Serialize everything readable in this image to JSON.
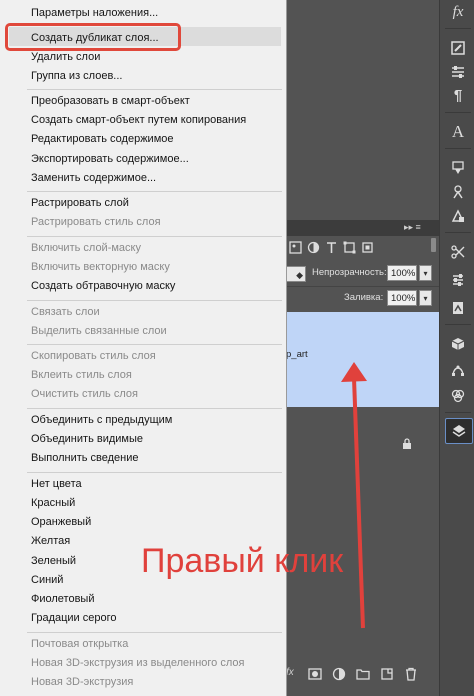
{
  "context_menu": {
    "items": [
      {
        "label": "Параметры наложения...",
        "enabled": true
      },
      {
        "label": "Создать дубликат слоя...",
        "enabled": true,
        "highlighted": true
      },
      {
        "label": "Удалить слои",
        "enabled": true
      },
      {
        "label": "Группа из слоев...",
        "enabled": true
      },
      {
        "label": "Преобразовать в смарт-объект",
        "enabled": true
      },
      {
        "label": "Создать смарт-объект путем копирования",
        "enabled": true
      },
      {
        "label": "Редактировать содержимое",
        "enabled": true
      },
      {
        "label": "Экспортировать содержимое...",
        "enabled": true
      },
      {
        "label": "Заменить содержимое...",
        "enabled": true
      },
      {
        "label": "Растрировать слой",
        "enabled": true
      },
      {
        "label": "Растрировать стиль слоя",
        "enabled": false
      },
      {
        "label": "Включить слой-маску",
        "enabled": false
      },
      {
        "label": "Включить векторную маску",
        "enabled": false
      },
      {
        "label": "Создать обтравочную маску",
        "enabled": true
      },
      {
        "label": "Связать слои",
        "enabled": false
      },
      {
        "label": "Выделить связанные слои",
        "enabled": false
      },
      {
        "label": "Скопировать стиль слоя",
        "enabled": false
      },
      {
        "label": "Вклеить стиль слоя",
        "enabled": false
      },
      {
        "label": "Очистить стиль слоя",
        "enabled": false
      },
      {
        "label": "Объединить с предыдущим",
        "enabled": true
      },
      {
        "label": "Объединить видимые",
        "enabled": true
      },
      {
        "label": "Выполнить сведение",
        "enabled": true
      },
      {
        "label": "Нет цвета",
        "enabled": true
      },
      {
        "label": "Красный",
        "enabled": true
      },
      {
        "label": "Оранжевый",
        "enabled": true
      },
      {
        "label": "Желтая",
        "enabled": true
      },
      {
        "label": "Зеленый",
        "enabled": true
      },
      {
        "label": "Синий",
        "enabled": true
      },
      {
        "label": "Фиолетовый",
        "enabled": true
      },
      {
        "label": "Градации серого",
        "enabled": true
      },
      {
        "label": "Почтовая открытка",
        "enabled": false
      },
      {
        "label": "Новая 3D-экструзия из выделенного слоя",
        "enabled": false
      },
      {
        "label": "Новая 3D-экструзия",
        "enabled": false
      }
    ]
  },
  "layers_panel": {
    "opacity_label": "Непрозрачность:",
    "opacity_value": "100%",
    "fill_label": "Заливка:",
    "fill_value": "100%",
    "selected_layer_name": "p_art",
    "panel_controls": "▸▸ ≡"
  },
  "toolbar": {
    "tools": [
      "fx-icon",
      "brush-settings-icon",
      "sliders-icon",
      "paragraph-icon",
      "character-icon",
      "layer-comps-icon",
      "clone-source-icon",
      "tool-presets-icon",
      "adjustments-icon",
      "3d-icon",
      "paths-icon",
      "layers-icon"
    ],
    "character_glyph": "A",
    "paragraph_glyph": "¶",
    "fx_glyph": "fx"
  },
  "annotation": {
    "caption": "Правый клик",
    "color": "#e0413c"
  },
  "colors": {
    "menu_bg": "#f0f0f0",
    "selected_layer": "#bfd5f7",
    "highlight_box": "#e0483b",
    "panel_bg": "#535353"
  }
}
